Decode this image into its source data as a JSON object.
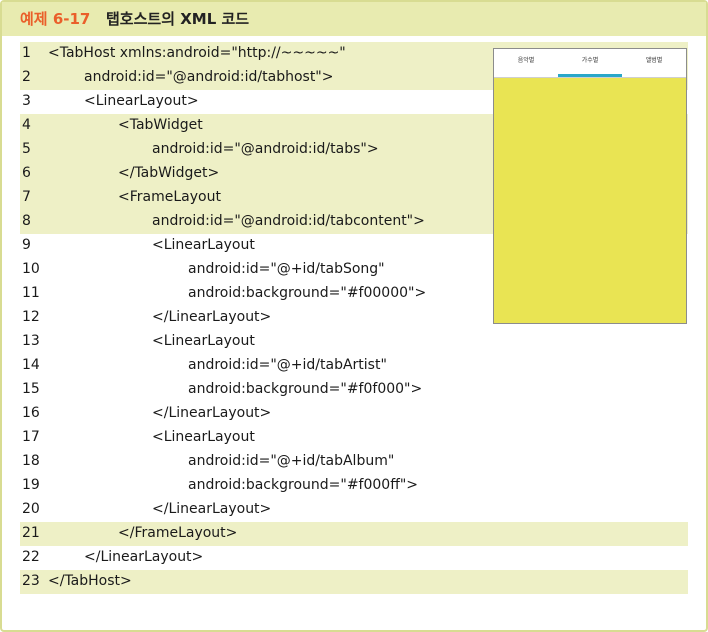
{
  "header": {
    "number": "예제 6-17",
    "title": "탭호스트의 XML 코드"
  },
  "code_lines": [
    {
      "n": "1",
      "text": "<TabHost xmlns:android=\"http://~~~~~\""
    },
    {
      "n": "2",
      "text": "android:id=\"@android:id/tabhost\">"
    },
    {
      "n": "3",
      "text": "<LinearLayout>"
    },
    {
      "n": "4",
      "text": "<TabWidget"
    },
    {
      "n": "5",
      "text": "android:id=\"@android:id/tabs\">"
    },
    {
      "n": "6",
      "text": "</TabWidget>"
    },
    {
      "n": "7",
      "text": "<FrameLayout"
    },
    {
      "n": "8",
      "text": "android:id=\"@android:id/tabcontent\">"
    },
    {
      "n": "9",
      "text": "<LinearLayout"
    },
    {
      "n": "10",
      "text": "android:id=\"@+id/tabSong\""
    },
    {
      "n": "11",
      "text": "android:background=\"#f00000\">"
    },
    {
      "n": "12",
      "text": "</LinearLayout>"
    },
    {
      "n": "13",
      "text": "<LinearLayout"
    },
    {
      "n": "14",
      "text": "android:id=\"@+id/tabArtist\""
    },
    {
      "n": "15",
      "text": "android:background=\"#f0f000\">"
    },
    {
      "n": "16",
      "text": "</LinearLayout>"
    },
    {
      "n": "17",
      "text": "<LinearLayout"
    },
    {
      "n": "18",
      "text": "android:id=\"@+id/tabAlbum\""
    },
    {
      "n": "19",
      "text": "android:background=\"#f000ff\">"
    },
    {
      "n": "20",
      "text": "</LinearLayout>"
    },
    {
      "n": "21",
      "text": "</FrameLayout>"
    },
    {
      "n": "22",
      "text": "</LinearLayout>"
    },
    {
      "n": "23",
      "text": "</TabHost>"
    }
  ],
  "preview": {
    "tabs": [
      "음악별",
      "가수별",
      "앨범별"
    ],
    "active_tab": "가수별",
    "content_color": "#e9e453"
  },
  "colors": {
    "accent": "#ea5f2a",
    "header_bg": "#e8ebb0",
    "highlight": "#eef0c6",
    "tab_indicator": "#2aa7c9"
  }
}
